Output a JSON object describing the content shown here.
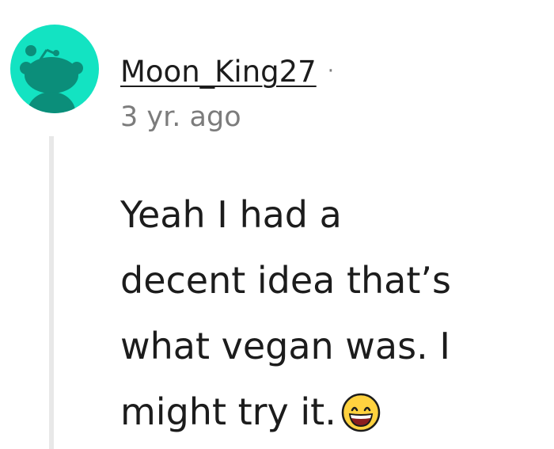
{
  "comment": {
    "avatar_icon": "reddit-snoo-icon",
    "avatar_color": "#13e3c2",
    "username": "Moon_King27",
    "separator": "·",
    "timestamp": "3 yr. ago",
    "body_lines": [
      "Yeah I had a",
      "decent idea that’s",
      "what vegan was. I",
      "might try it."
    ],
    "emoji": "grinning-face-icon"
  }
}
